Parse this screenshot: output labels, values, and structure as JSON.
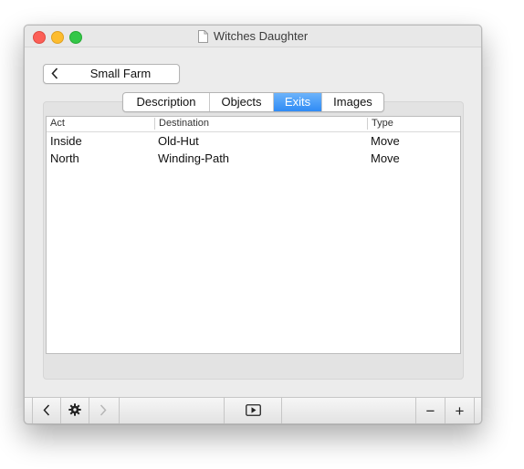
{
  "window": {
    "title": "Witches Daughter"
  },
  "nav": {
    "back_label": "Small Farm"
  },
  "tabs": [
    {
      "label": "Description",
      "active": false
    },
    {
      "label": "Objects",
      "active": false
    },
    {
      "label": "Exits",
      "active": true
    },
    {
      "label": "Images",
      "active": false
    }
  ],
  "table": {
    "columns": [
      "Act",
      "Destination",
      "Type"
    ],
    "rows": [
      {
        "act": "Inside",
        "destination": "Old-Hut",
        "type": "Move"
      },
      {
        "act": "North",
        "destination": "Winding-Path",
        "type": "Move"
      }
    ]
  },
  "toolbar": {
    "back_icon": "chevron-left-icon",
    "settings_icon": "gear-icon",
    "forward_icon": "chevron-right-icon",
    "play_icon": "play-icon",
    "remove_label": "−",
    "add_label": "+"
  },
  "colors": {
    "accent": "#2f8bf5",
    "close": "#fc5f57",
    "minimize": "#fdbc2e",
    "maximize": "#33c748"
  }
}
